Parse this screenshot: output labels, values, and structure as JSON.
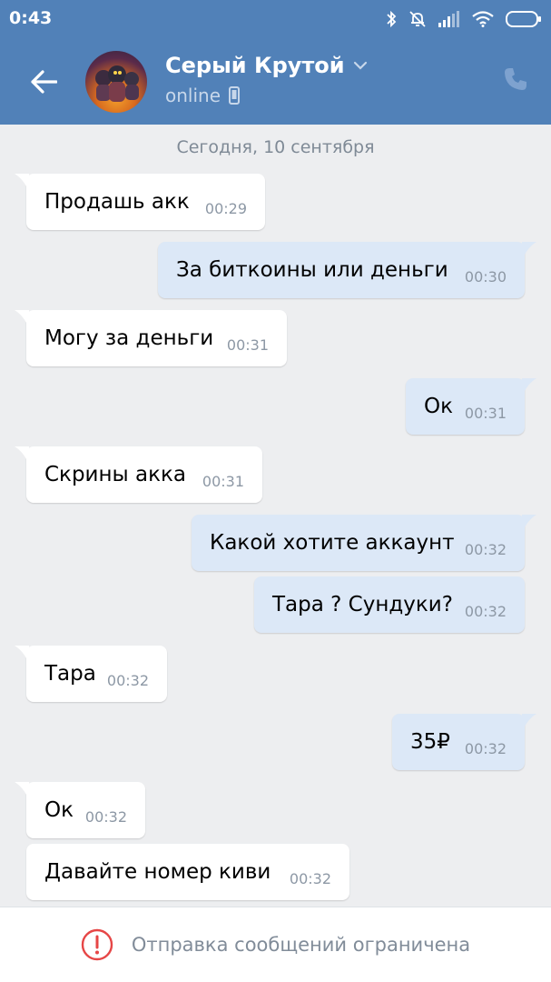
{
  "status_bar": {
    "time": "0:43"
  },
  "header": {
    "contact_name": "Серый Крутой",
    "status": "online"
  },
  "chat": {
    "date_separator": "Сегодня, 10 сентября",
    "messages": [
      {
        "dir": "in",
        "text": "Продашь акк",
        "time": "00:29"
      },
      {
        "dir": "out",
        "text": "За биткоины или деньги",
        "time": "00:30"
      },
      {
        "dir": "in",
        "text": "Могу за деньги",
        "time": "00:31"
      },
      {
        "dir": "out",
        "text": "Ок",
        "time": "00:31"
      },
      {
        "dir": "in",
        "text": "Скрины акка",
        "time": "00:31"
      },
      {
        "dir": "out",
        "text": "Какой хотите аккаунт",
        "time": "00:32"
      },
      {
        "dir": "out",
        "text": "Тара ? Сундуки?",
        "time": "00:32"
      },
      {
        "dir": "in",
        "text": "Тара",
        "time": "00:32"
      },
      {
        "dir": "out",
        "text": "35₽",
        "time": "00:32"
      },
      {
        "dir": "in",
        "text": "Ок",
        "time": "00:32"
      },
      {
        "dir": "in",
        "text": "Давайте номер киви",
        "time": "00:32"
      }
    ]
  },
  "footer": {
    "notice": "Отправка сообщений ограничена"
  },
  "colors": {
    "header": "#5181b8",
    "background": "#edeef0",
    "incoming": "#ffffff",
    "outgoing": "#dce8f7",
    "warning": "#e64646"
  }
}
